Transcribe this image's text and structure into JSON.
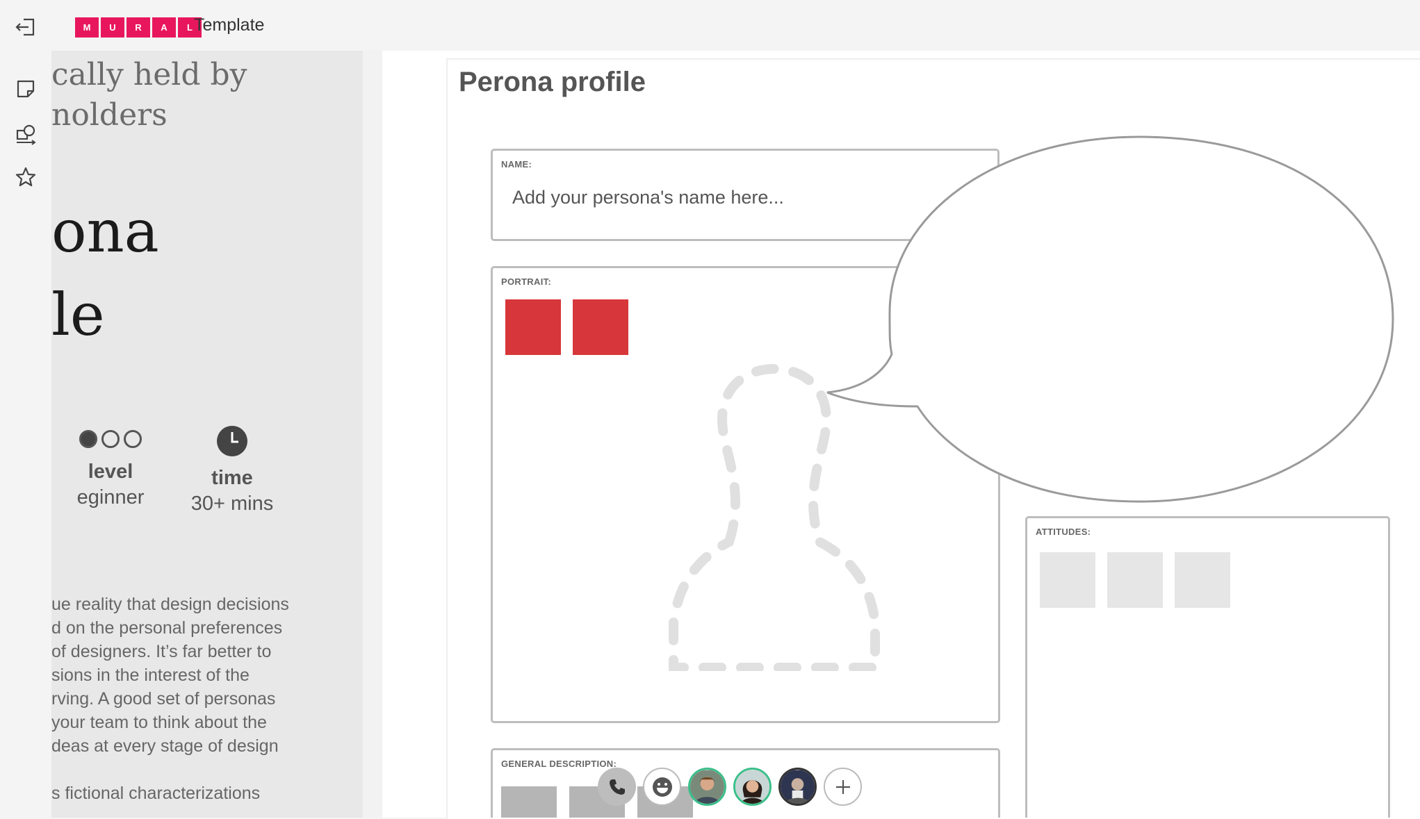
{
  "header": {
    "logo_letters": [
      "M",
      "U",
      "R",
      "A",
      "L"
    ],
    "template_label": "Template",
    "brand_color": "#e8175d"
  },
  "rail": {
    "icons": [
      "exit-icon",
      "sticky-note-icon",
      "templates-icon",
      "star-icon"
    ]
  },
  "side_panel": {
    "subtitle_line1": "cally held by",
    "subtitle_line2": "nolders",
    "title_line1": "ona",
    "title_line2": "le",
    "level_label": "level",
    "level_value": "eginner",
    "level_filled_fraction": 0.333,
    "time_label": "time",
    "time_value": "30+ mins",
    "description_lines": [
      "ue reality that design decisions",
      "d on the personal preferences",
      "of designers. It’s far better to",
      "sions in the interest of the",
      "rving. A good set of personas",
      "your team to think about the",
      "deas at every stage of design",
      "",
      "s fictional characterizations"
    ]
  },
  "board": {
    "title": "Perona profile",
    "name_label": "NAME:",
    "name_placeholder": "Add your persona's name here...",
    "portrait_label": "PORTRAIT:",
    "attitudes_label": "ATTITUDES:",
    "general_label": "GENERAL DESCRIPTION:",
    "accent_red": "#d7363a"
  },
  "bottom_bar": {
    "buttons": [
      "phone-icon",
      "emoji-icon",
      "avatar-1",
      "avatar-2",
      "avatar-3",
      "add-icon"
    ]
  }
}
